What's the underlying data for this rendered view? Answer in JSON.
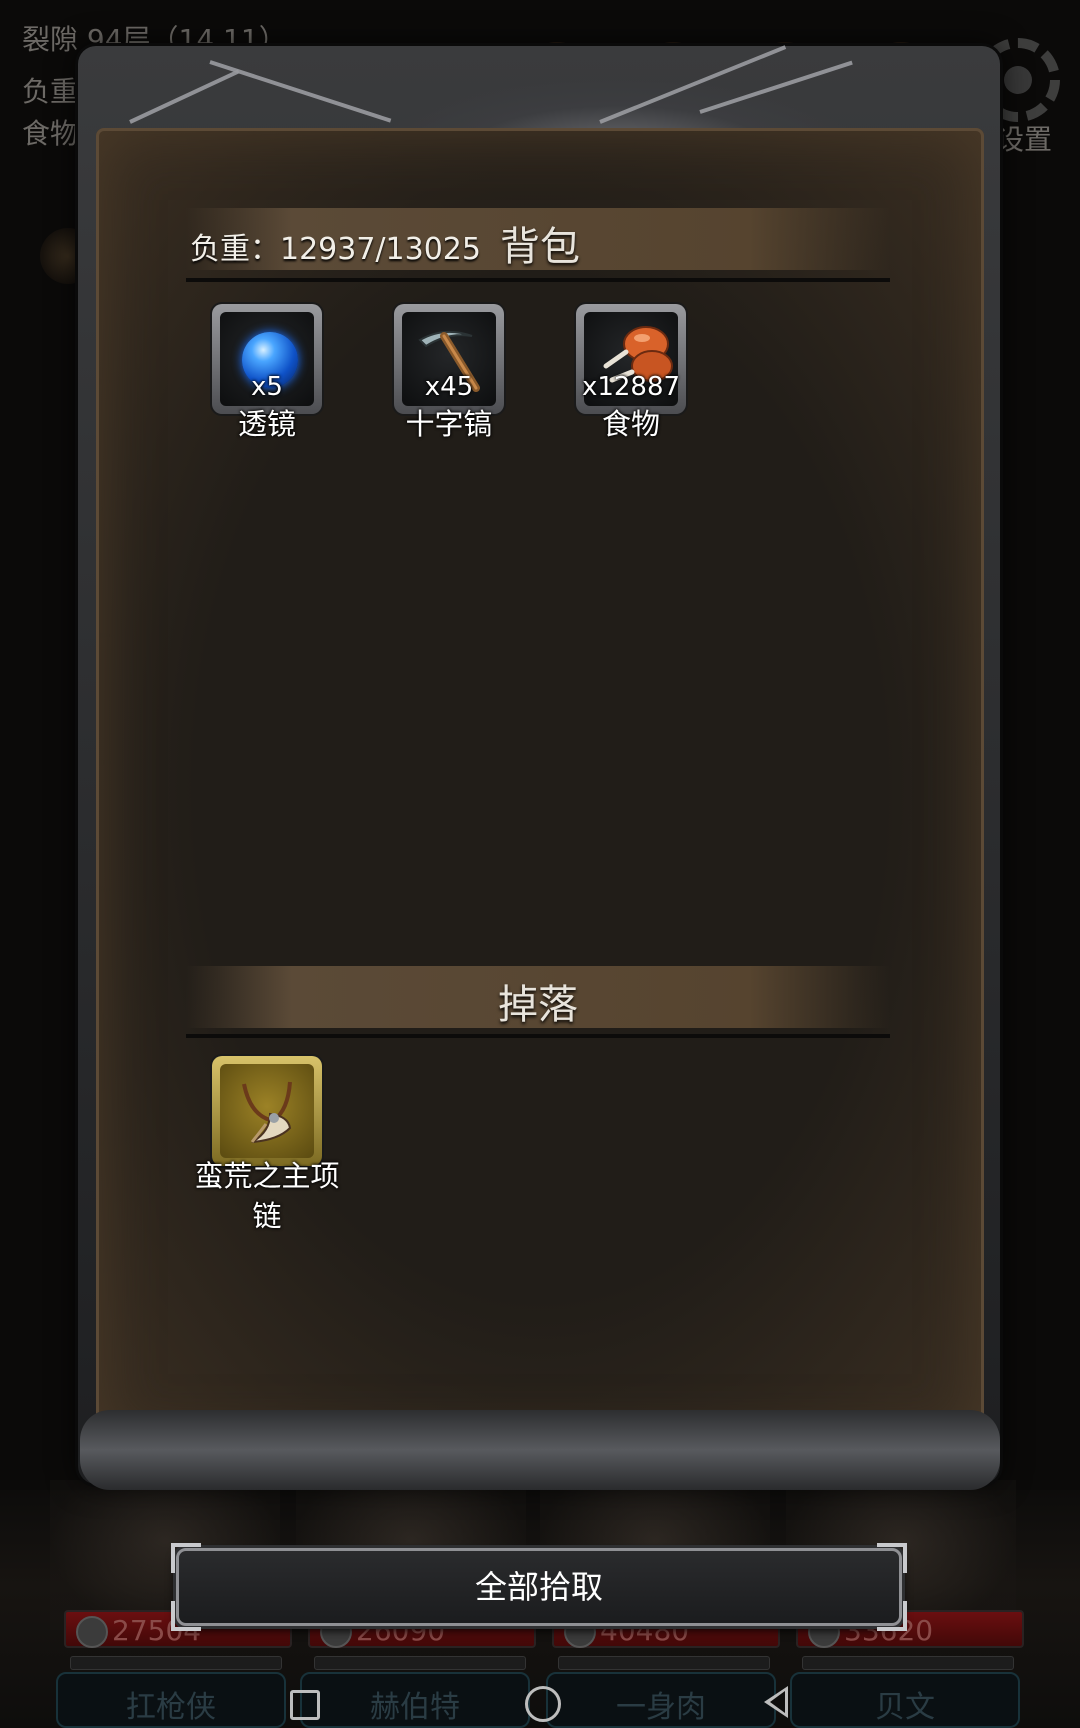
{
  "hud": {
    "location": "裂隙 94层（14,11）",
    "weight_prefix": "负重",
    "food_prefix": "食物",
    "settings_label": "设置"
  },
  "party": [
    {
      "hp": "27504",
      "name": "扛枪侠"
    },
    {
      "hp": "26090",
      "name": "赫伯特"
    },
    {
      "hp": "40480",
      "name": "一身肉"
    },
    {
      "hp": "33620",
      "name": "贝文"
    }
  ],
  "inventory": {
    "weight_text": "负重：12937/13025",
    "title": "背包",
    "items": [
      {
        "icon": "lens-icon",
        "count": "x5",
        "name": "透镜"
      },
      {
        "icon": "pickaxe-icon",
        "count": "x45",
        "name": "十字镐"
      },
      {
        "icon": "food-icon",
        "count": "x12887",
        "name": "食物"
      }
    ]
  },
  "drops": {
    "title": "掉落",
    "items": [
      {
        "icon": "necklace-icon",
        "name_line1": "蛮荒之主项",
        "name_line2": "链",
        "rarity_color": "#c9ad3e"
      }
    ]
  },
  "collect_all_label": "全部拾取",
  "colors": {
    "panel_bg": "#211d18",
    "header_band": "#56442f",
    "hp_bar": "#6b0f10"
  }
}
